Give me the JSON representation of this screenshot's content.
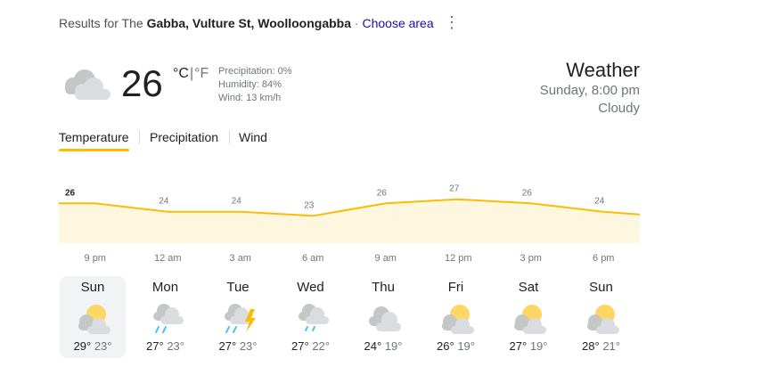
{
  "header": {
    "results_prefix": "Results for The",
    "location": "Gabba, Vulture St, Woolloongabba",
    "separator": "·",
    "choose_area": "Choose area",
    "menu_icon": "more-vert-icon"
  },
  "current": {
    "icon": "cloudy-icon",
    "temperature": "26",
    "unit_c": "°C",
    "unit_sep": "|",
    "unit_f": "°F",
    "precipitation": "Precipitation: 0%",
    "humidity": "Humidity: 84%",
    "wind": "Wind: 13 km/h"
  },
  "summary": {
    "title": "Weather",
    "time": "Sunday, 8:00 pm",
    "condition": "Cloudy"
  },
  "tabs": [
    {
      "label": "Temperature",
      "selected": true
    },
    {
      "label": "Precipitation",
      "selected": false
    },
    {
      "label": "Wind",
      "selected": false
    }
  ],
  "chart_data": {
    "type": "area",
    "x": [
      "9 pm",
      "12 am",
      "3 am",
      "6 am",
      "9 am",
      "12 pm",
      "3 pm",
      "6 pm"
    ],
    "values": [
      26,
      24,
      24,
      23,
      26,
      27,
      26,
      24
    ],
    "first_label_bold": true,
    "line_color": "#fbbc04",
    "fill_color": "#fef7e0"
  },
  "days": [
    {
      "name": "Sun",
      "icon": "partly-cloudy-icon",
      "high": "29°",
      "low": "23°",
      "selected": true
    },
    {
      "name": "Mon",
      "icon": "rain-cloud-icon",
      "high": "27°",
      "low": "23°",
      "selected": false
    },
    {
      "name": "Tue",
      "icon": "thunderstorm-icon",
      "high": "27°",
      "low": "23°",
      "selected": false
    },
    {
      "name": "Wed",
      "icon": "showers-icon",
      "high": "27°",
      "low": "22°",
      "selected": false
    },
    {
      "name": "Thu",
      "icon": "cloudy-icon",
      "high": "24°",
      "low": "19°",
      "selected": false
    },
    {
      "name": "Fri",
      "icon": "partly-cloudy-icon",
      "high": "26°",
      "low": "19°",
      "selected": false
    },
    {
      "name": "Sat",
      "icon": "partly-cloudy-icon",
      "high": "27°",
      "low": "19°",
      "selected": false
    },
    {
      "name": "Sun",
      "icon": "partly-cloudy-icon",
      "high": "28°",
      "low": "21°",
      "selected": false
    }
  ]
}
